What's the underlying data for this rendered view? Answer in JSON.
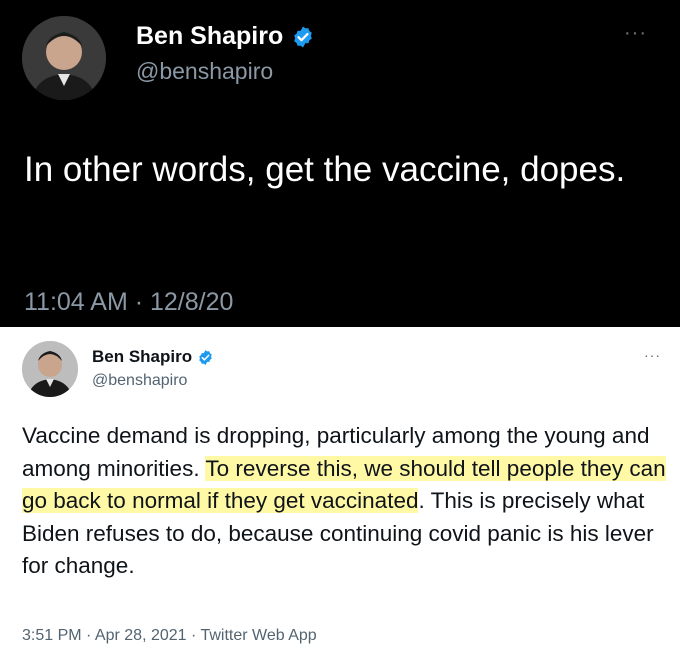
{
  "tweet1": {
    "name": "Ben Shapiro",
    "handle": "@benshapiro",
    "more": "···",
    "text": "In other words, get the vaccine, dopes.",
    "meta": "11:04 AM · 12/8/20"
  },
  "tweet2": {
    "name": "Ben Shapiro",
    "handle": "@benshapiro",
    "more": "···",
    "text_before": "Vaccine demand is dropping, particularly among the young and among minorities. ",
    "text_highlight": "To reverse this, we should tell people they can go back to normal if they get vaccinated",
    "text_after": ". This is precisely what Biden refuses to do, because continuing covid panic is his lever for change.",
    "meta": "3:51 PM · Apr 28, 2021 · Twitter Web App"
  },
  "colors": {
    "verified": "#1d9bf0",
    "highlight": "#fff9a6",
    "dark_bg": "#000000"
  },
  "icons": {
    "verified": "verified-badge-icon",
    "more": "more-options-icon"
  }
}
